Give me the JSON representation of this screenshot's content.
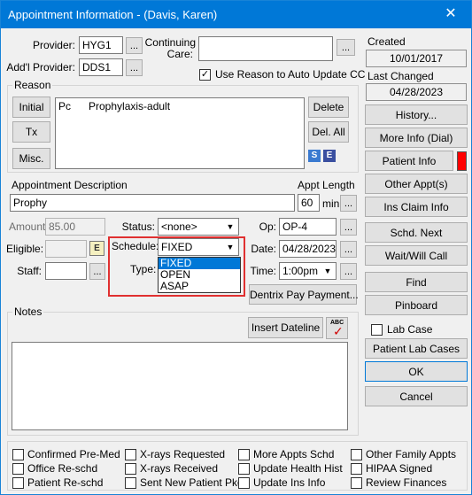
{
  "window": {
    "title": "Appointment Information - (Davis, Karen)"
  },
  "provider": {
    "label": "Provider:",
    "value": "HYG1",
    "more": "..."
  },
  "addl_provider": {
    "label": "Add'l Provider:",
    "value": "DDS1",
    "more": "..."
  },
  "continuing_care": {
    "label_1": "Continuing",
    "label_2": "Care:",
    "value": "",
    "more": "..."
  },
  "use_reason": {
    "checked": true,
    "label": "Use Reason to Auto Update CC"
  },
  "reason": {
    "group_label": "Reason",
    "buttons": [
      "Initial",
      "Tx",
      "Misc."
    ],
    "entries": [
      {
        "code": "Pc",
        "desc": "Prophylaxis-adult"
      }
    ],
    "delete_label": "Delete",
    "delete_all_label": "Del. All",
    "icon_s": "S",
    "icon_e": "E"
  },
  "appt_desc": {
    "label": "Appointment Description",
    "value": "Prophy"
  },
  "appt_length": {
    "label": "Appt Length",
    "value": "60",
    "unit": "min",
    "more": "..."
  },
  "amount": {
    "label": "Amount:",
    "value": "85.00"
  },
  "eligible": {
    "label": "Eligible:",
    "value": "",
    "button": "E"
  },
  "staff": {
    "label": "Staff:",
    "value": "",
    "more": "..."
  },
  "status": {
    "label": "Status:",
    "value": "<none>"
  },
  "schedule": {
    "label": "Schedule:",
    "value": "FIXED",
    "type_label": "Type:",
    "options": [
      "FIXED",
      "OPEN",
      "ASAP"
    ],
    "selected_index": 0
  },
  "op": {
    "label": "Op:",
    "value": "OP-4",
    "more": "..."
  },
  "date": {
    "label": "Date:",
    "value": "04/28/2023",
    "more": "..."
  },
  "time": {
    "label": "Time:",
    "value": "1:00pm",
    "more": "..."
  },
  "dentrix_pay": {
    "label": "Dentrix Pay Payment..."
  },
  "notes": {
    "group_label": "Notes",
    "insert_dateline": "Insert Dateline",
    "spell_label": "ABC",
    "value": ""
  },
  "created": {
    "label": "Created",
    "value": "10/01/2017"
  },
  "last_changed": {
    "label": "Last Changed",
    "value": "04/28/2023"
  },
  "right_buttons": {
    "history": "History...",
    "more_info": "More Info (Dial)",
    "patient_info": "Patient Info",
    "other_appts": "Other Appt(s)",
    "ins_claim": "Ins Claim Info",
    "schd_next": "Schd. Next",
    "wait_will_call": "Wait/Will Call",
    "find": "Find",
    "pinboard": "Pinboard",
    "patient_lab_cases": "Patient Lab Cases",
    "ok": "OK",
    "cancel": "Cancel"
  },
  "lab_case": {
    "checked": false,
    "label": "Lab Case"
  },
  "patient_info_flag_color": "#ff0000",
  "bottom_checks": [
    {
      "label": "Confirmed Pre-Med",
      "checked": false
    },
    {
      "label": "X-rays Requested",
      "checked": false
    },
    {
      "label": "More Appts Schd",
      "checked": false
    },
    {
      "label": "Other Family Appts",
      "checked": false
    },
    {
      "label": "Office Re-schd",
      "checked": false
    },
    {
      "label": "X-rays Received",
      "checked": false
    },
    {
      "label": "Update Health Hist",
      "checked": false
    },
    {
      "label": "HIPAA Signed",
      "checked": false
    },
    {
      "label": "Patient Re-schd",
      "checked": false
    },
    {
      "label": "Sent New Patient Pkg",
      "checked": false
    },
    {
      "label": "Update Ins Info",
      "checked": false
    },
    {
      "label": "Review Finances",
      "checked": false
    }
  ],
  "colors": {
    "titlebar": "#0078d7",
    "highlight": "#0078d7",
    "dropdown_outline": "#e03030"
  }
}
